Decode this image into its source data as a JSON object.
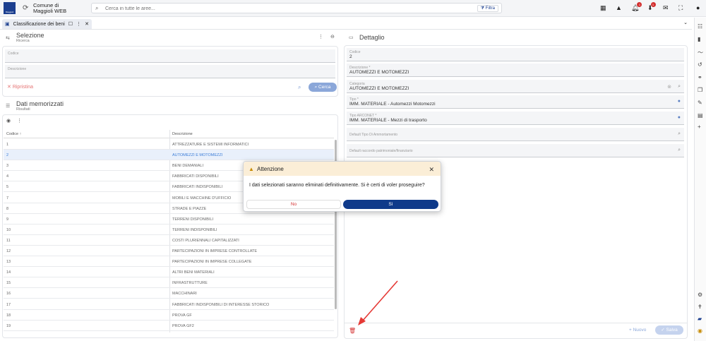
{
  "topbar": {
    "org_name": "Comune di Maggioli WEB",
    "search_placeholder": "Cerca in tutte le aree...",
    "filter_label": "Filtra",
    "badge1": "1",
    "badge2": "1"
  },
  "tab": {
    "label": "Classificazione dei beni"
  },
  "selezione": {
    "title": "Selezione",
    "subtitle": "Ricerca",
    "codice_label": "Codice",
    "descrizione_label": "Descrizione",
    "reset_label": "Ripristina",
    "search_label": "Cerca"
  },
  "dati": {
    "title": "Dati memorizzati",
    "subtitle": "Risultati",
    "col_codice": "Codice",
    "col_descrizione": "Descrizione",
    "rows": [
      {
        "c": "1",
        "d": "ATTREZZATURE E SISTEMI INFORMATICI"
      },
      {
        "c": "2",
        "d": "AUTOMEZZI E MOTOMEZZI"
      },
      {
        "c": "3",
        "d": "BENI DEMANIALI"
      },
      {
        "c": "4",
        "d": "FABBRICATI DISPONIBILI"
      },
      {
        "c": "5",
        "d": "FABBRICATI INDISPONIBILI"
      },
      {
        "c": "7",
        "d": "MOBILI E MACCHINE D'UFFICIO"
      },
      {
        "c": "8",
        "d": "STRADE E PIAZZE"
      },
      {
        "c": "9",
        "d": "TERRENI DISPONIBILI"
      },
      {
        "c": "10",
        "d": "TERRENI INDISPONIBILI"
      },
      {
        "c": "11",
        "d": "COSTI PLURIENNALI CAPITALIZZATI"
      },
      {
        "c": "12",
        "d": "PARTECIPAZIONI IN IMPRESE CONTROLLATE"
      },
      {
        "c": "13",
        "d": "PARTECIPAZIONI IN IMPRESE COLLEGATE"
      },
      {
        "c": "14",
        "d": "ALTRI BENI MATERIALI"
      },
      {
        "c": "15",
        "d": "INFRASTRUTTURE"
      },
      {
        "c": "16",
        "d": "MACCHINARI"
      },
      {
        "c": "17",
        "d": "FABBRICATI INDISPONIBILI DI INTERESSE STORICO"
      },
      {
        "c": "18",
        "d": "PROVA GF"
      },
      {
        "c": "19",
        "d": "PROVA GF2"
      }
    ]
  },
  "dettaglio": {
    "title": "Dettaglio",
    "codice_label": "Codice",
    "codice_value": "2",
    "descrizione_label": "Descrizione *",
    "descrizione_value": "AUTOMEZZI E MOTOMEZZI",
    "categoria_label": "Categoria",
    "categoria_value": "AUTOMEZZI E MOTOMEZZI",
    "tipo_label": "Tipo *",
    "tipo_value": "IMM. MATERIALE - Automezzi Motomezzi",
    "tipo_arconet_label": "Tipo ARCONET *",
    "tipo_arconet_value": "IMM. MATERIALE - Mezzi di trasporto",
    "ammortamento_label": "Default Tipo Di Ammortamento",
    "raccordo_label": "Default raccordo patrimoniale/finanziario",
    "nuovo_label": "+ Nuovo",
    "salva_label": "Salva"
  },
  "dialog": {
    "title": "Attenzione",
    "message": "I dati selezionati saranno eliminati definitivamente. Si è certi di voler proseguire?",
    "no_label": "No",
    "si_label": "Sì"
  },
  "colors": {
    "accent": "#0f3a8a",
    "danger": "#d32f2f",
    "warning_bg": "#fbeed7"
  }
}
